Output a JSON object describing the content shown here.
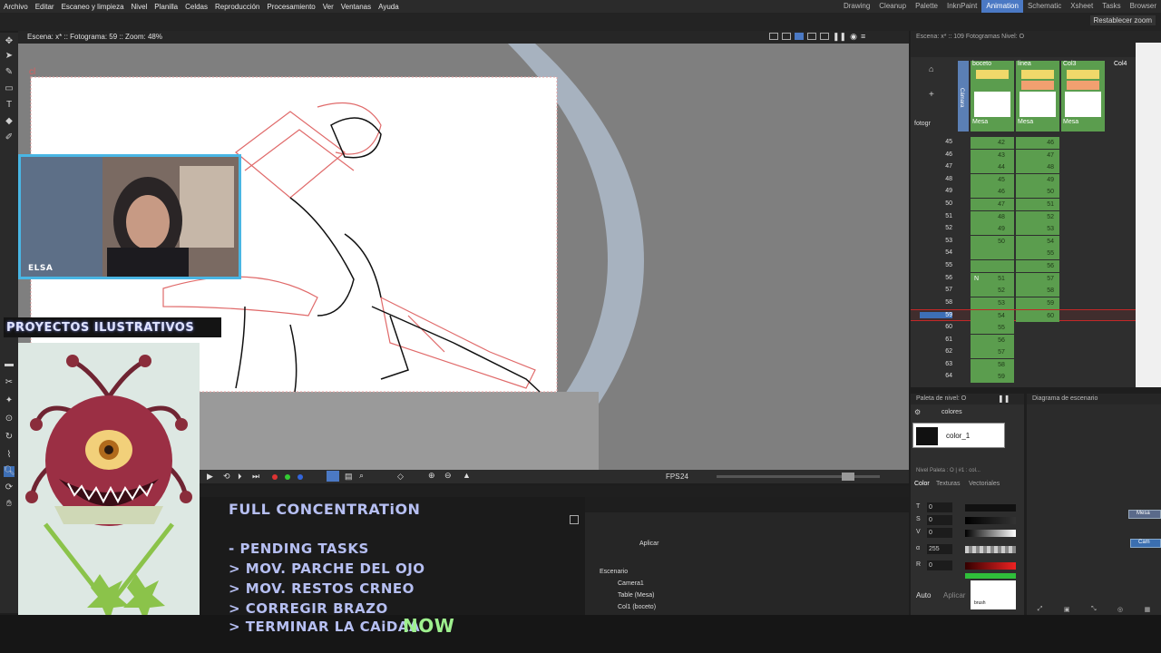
{
  "menubar": {
    "items": [
      "Archivo",
      "Editar",
      "Escaneo y limpieza",
      "Nivel",
      "Planilla",
      "Celdas",
      "Reproducción",
      "Procesamiento",
      "Ver",
      "Ventanas",
      "Ayuda"
    ],
    "rooms": [
      "Drawing",
      "Cleanup",
      "Palette",
      "InknPaint",
      "Animation",
      "Schematic",
      "Xsheet",
      "Tasks",
      "Browser"
    ],
    "active_room": "Animation",
    "reset_zoom": "Restablecer zoom"
  },
  "viewer": {
    "title": "Escena: x* :: Fotograma: 59 :: Zoom: 48%",
    "frame_label": "cl",
    "fps_label": "FPS",
    "fps_value": "24"
  },
  "overlay": {
    "webcam_caption": "ELSA",
    "project_title": "PROYECTOS ILUSTRATIVOS",
    "concentration": "FULL CONCENTRATiON",
    "tasks_header": "- PENDING TASKS",
    "tasks": [
      "> MOV. PARCHE DEL OJO",
      "> MOV. RESTOS CRNEO",
      "> CORREGIR BRAZO",
      "> TERMINAR LA CAiDAA"
    ],
    "now_label": "NOW"
  },
  "lower_right": {
    "apply": "Aplicar",
    "tree": [
      "Escenario",
      "Camera1",
      "Table (Mesa)",
      "Col1 (boceto)"
    ]
  },
  "xsheet": {
    "title": "Escena: x* :: 109 Fotogramas Nivel: O",
    "frame_selector": "fotogr",
    "camera_label": "Cámara",
    "columns": [
      {
        "name": "boceto",
        "level": "Mesa"
      },
      {
        "name": "linea",
        "level": "Mesa"
      },
      {
        "name": "Col3",
        "level": "Mesa"
      },
      {
        "name": "Col4",
        "level": ""
      }
    ],
    "rows": [
      {
        "frame": "45",
        "c1": "42",
        "c2": "46"
      },
      {
        "frame": "46",
        "c1": "43",
        "c2": "47"
      },
      {
        "frame": "47",
        "c1": "44",
        "c2": "48"
      },
      {
        "frame": "48",
        "c1": "45",
        "c2": "49"
      },
      {
        "frame": "49",
        "c1": "46",
        "c2": "50"
      },
      {
        "frame": "50",
        "c1": "47",
        "c2": "51"
      },
      {
        "frame": "51",
        "c1": "48",
        "c2": "52"
      },
      {
        "frame": "52",
        "c1": "49",
        "c2": "53"
      },
      {
        "frame": "53",
        "c1": "50",
        "c2": "54"
      },
      {
        "frame": "54",
        "c1": "",
        "c2": "55"
      },
      {
        "frame": "55",
        "c1": "",
        "c2": "56"
      },
      {
        "frame": "56",
        "c0": "N",
        "c1": "51",
        "c2": "57"
      },
      {
        "frame": "57",
        "c1": "52",
        "c2": "58"
      },
      {
        "frame": "58",
        "c1": "53",
        "c2": "59"
      },
      {
        "frame": "59",
        "c1": "54",
        "c2": "60"
      },
      {
        "frame": "60",
        "c1": "55",
        "c2": ""
      },
      {
        "frame": "61",
        "c1": "56",
        "c2": ""
      },
      {
        "frame": "62",
        "c1": "57",
        "c2": ""
      },
      {
        "frame": "63",
        "c1": "58",
        "c2": ""
      },
      {
        "frame": "64",
        "c1": "59",
        "c2": ""
      }
    ],
    "current_frame": "59"
  },
  "palette": {
    "title": "Paleta de nivel: O",
    "palette_name": "colores",
    "style_name": "color_1",
    "level_palette_label": "Nivel Paleta : O | #1 : col...",
    "tabs": [
      "Color",
      "Texturas",
      "Vectoriales"
    ],
    "channels": [
      {
        "label": "T",
        "value": "0"
      },
      {
        "label": "S",
        "value": "0"
      },
      {
        "label": "V",
        "value": "0"
      },
      {
        "label": "α",
        "value": "255"
      },
      {
        "label": "R",
        "value": "0"
      }
    ],
    "auto": "Auto",
    "apply": "Aplicar",
    "brush_label": "brush"
  },
  "scene": {
    "title": "Diagrama de escenario",
    "nodes": [
      "Mesa",
      "Cam"
    ]
  },
  "colors": {
    "accent": "#4b79c4",
    "xsheet_green": "#5b9d4e",
    "current_row": "#c22828",
    "overlay_text": "#b6bff2",
    "now_green": "#9ef08e"
  }
}
